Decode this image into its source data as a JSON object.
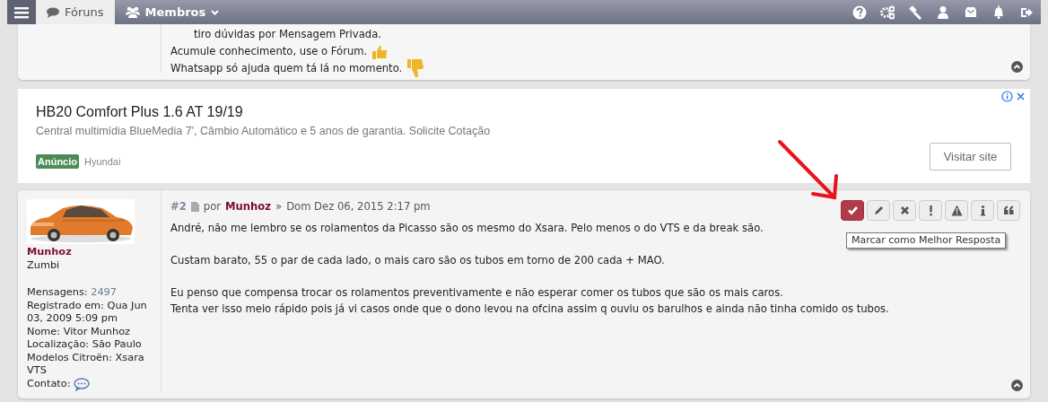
{
  "navbar": {
    "tabs": [
      {
        "label": "Fóruns",
        "kind": "forums",
        "selected": true
      },
      {
        "label": "Membros",
        "kind": "members",
        "selected": false
      }
    ],
    "tools": [
      {
        "kind": "help"
      },
      {
        "kind": "settings"
      },
      {
        "kind": "moderation"
      },
      {
        "kind": "user"
      },
      {
        "kind": "inbox"
      },
      {
        "kind": "notifications"
      },
      {
        "kind": "logout"
      }
    ]
  },
  "previous_post": {
    "signature": [
      {
        "text": "tiro dúvidas por Mensagem Privada.",
        "kind": "plain"
      },
      {
        "text": "Acumule conhecimento, use o Fórum.",
        "kind": "thumbs-up"
      },
      {
        "text": "Whatsapp só ajuda quem tá lá no momento.",
        "kind": "thumbs-down"
      }
    ]
  },
  "ad": {
    "title": "HB20 Comfort Plus 1.6 AT 19/19",
    "description": "Central multimídia BlueMedia 7', Câmbio Automático e 5 anos de garantia. Solicite Cotação",
    "badge": "Anúncio",
    "advertiser": "Hyundai",
    "button": "Visitar site"
  },
  "post": {
    "number": "#2",
    "by": "por",
    "author": "Munhoz",
    "separator": "»",
    "date": "Dom Dez 06, 2015 2:17 pm",
    "paragraphs": [
      [
        "André, não me lembro se os rolamentos da Picasso são os mesmo do Xsara. Pelo menos o do VTS e da break são."
      ],
      [
        "Custam barato, 55 o par de cada lado, o mais caro são os tubos em torno de 200 cada + MAO."
      ],
      [
        "Eu penso que compensa trocar os rolamentos preventivamente e não esperar comer os tubos que são os mais caros.",
        "Tenta ver isso meio rápido pois já vi casos onde que o dono levou na ofcina assim q ouviu os barulhos e ainda não tinha comido os tubos."
      ]
    ],
    "user": {
      "name": "Munhoz",
      "rank": "Zumbi",
      "fields": [
        {
          "label": "Mensagens:",
          "value": "2497",
          "kind": "count"
        },
        {
          "label": "Registrado em:",
          "value": "Qua Jun 03, 2009 5:09 pm",
          "kind": "text"
        },
        {
          "label": "Nome:",
          "value": "Vitor Munhoz",
          "kind": "text"
        },
        {
          "label": "Localização:",
          "value": "São Paulo",
          "kind": "text"
        },
        {
          "label": "Modelos Citroën:",
          "value": "Xsara VTS",
          "kind": "text"
        }
      ],
      "contact_label": "Contato:"
    },
    "actions": [
      {
        "kind": "best-answer",
        "selected": true
      },
      {
        "kind": "edit",
        "selected": false
      },
      {
        "kind": "delete",
        "selected": false
      },
      {
        "kind": "report",
        "selected": false
      },
      {
        "kind": "warn",
        "selected": false
      },
      {
        "kind": "info",
        "selected": false
      },
      {
        "kind": "quote",
        "selected": false
      }
    ],
    "tooltip": "Marcar como Melhor Resposta"
  }
}
